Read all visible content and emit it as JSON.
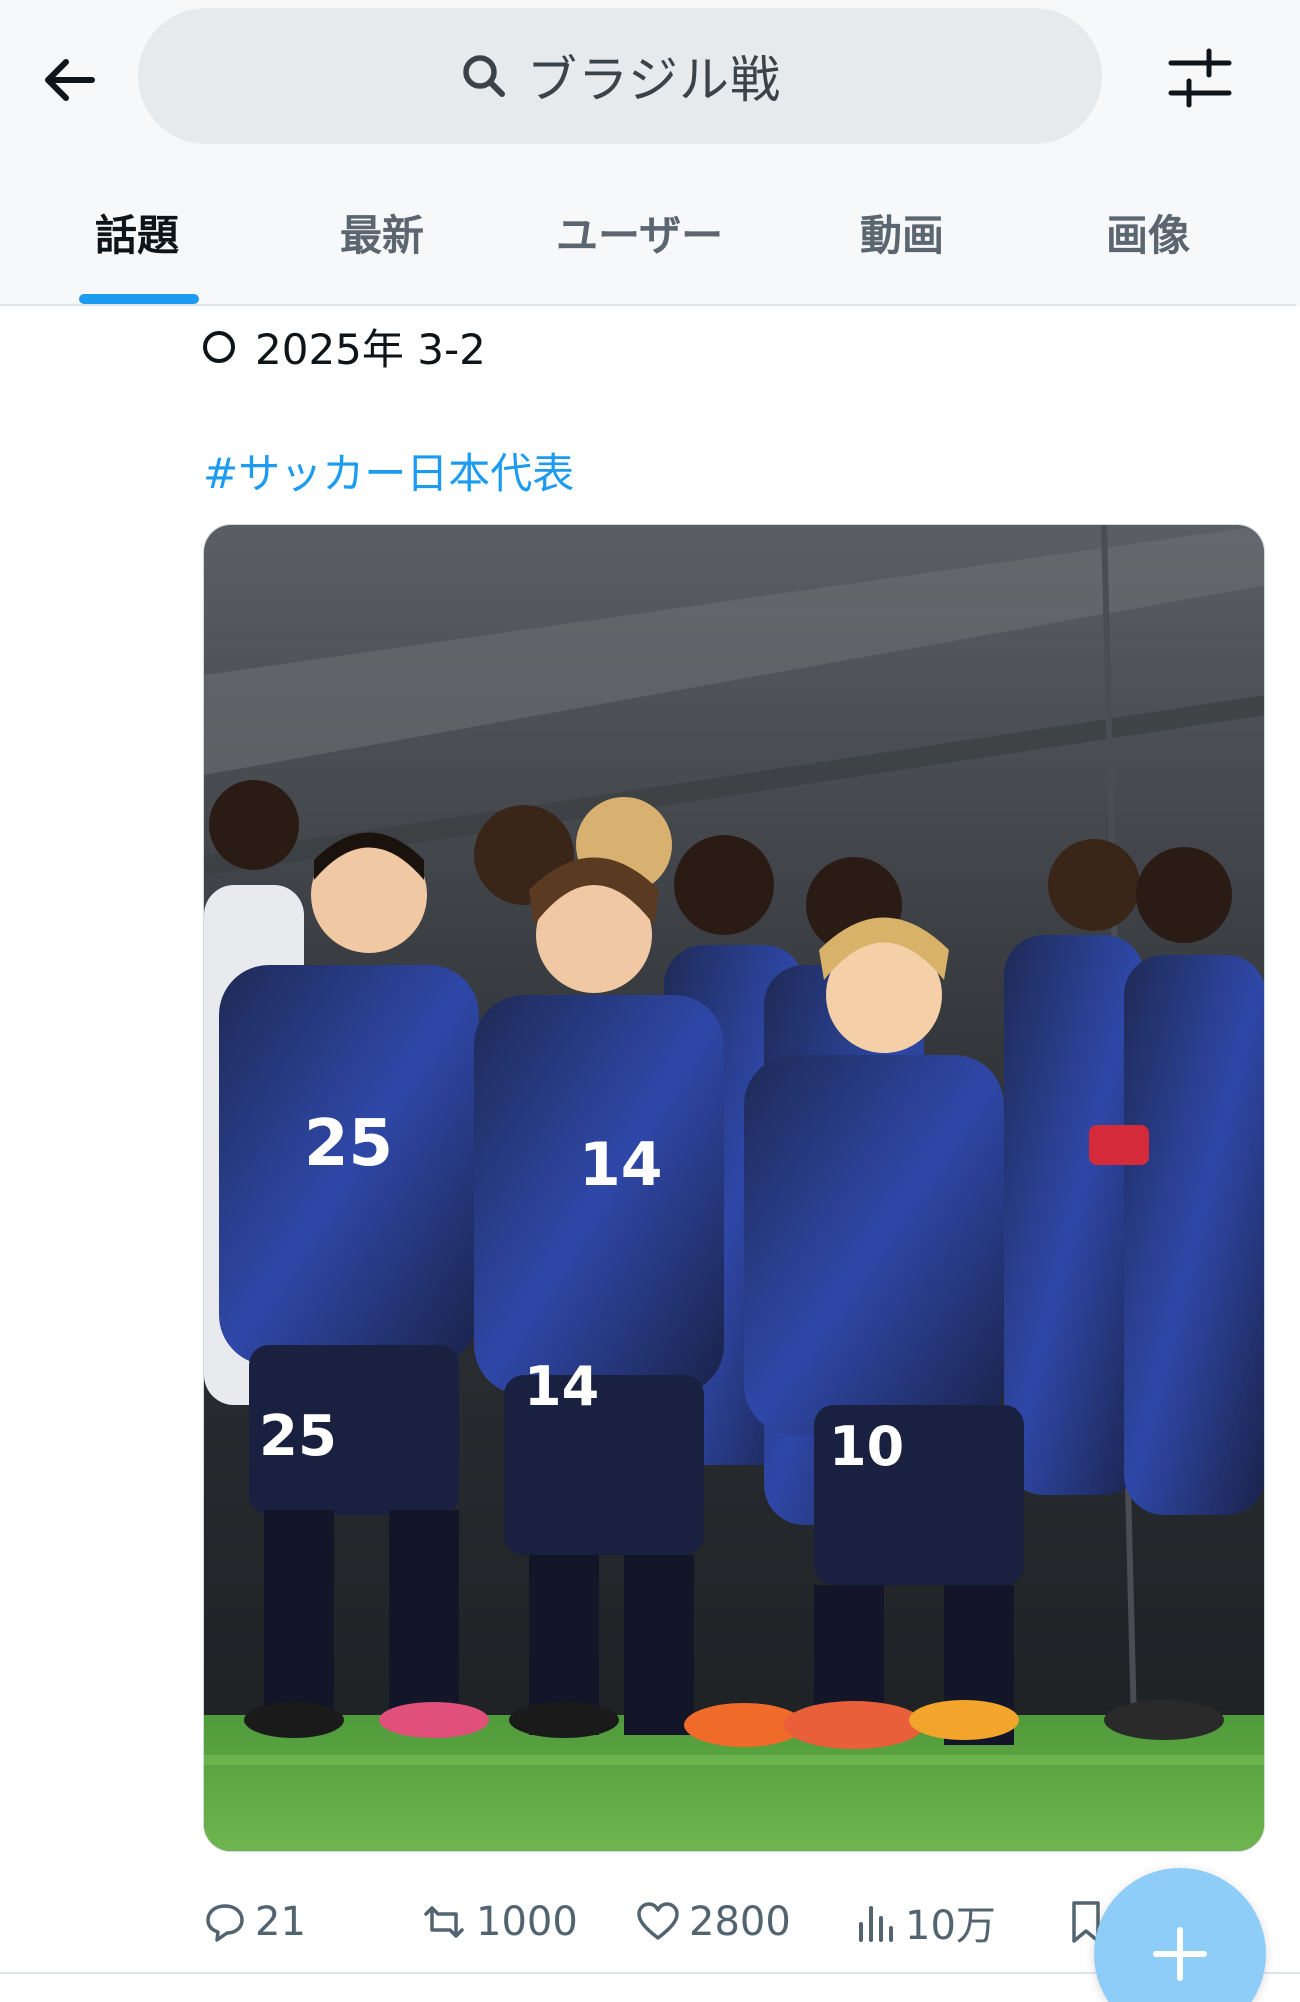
{
  "search": {
    "query": "ブラジル戦"
  },
  "tabs": [
    {
      "label": "話題",
      "active": true
    },
    {
      "label": "最新",
      "active": false
    },
    {
      "label": "ユーザー",
      "active": false
    },
    {
      "label": "動画",
      "active": false
    },
    {
      "label": "画像",
      "active": false
    }
  ],
  "tweet": {
    "result_text": "2025年 3-2",
    "hashtag": "#サッカー日本代表",
    "stats": {
      "replies": "21",
      "retweets": "1000",
      "likes": "2800",
      "views": "10万"
    }
  },
  "colors": {
    "accent": "#1d9bf0",
    "fab": "#8ecdf8",
    "jersey": "#1e2a55",
    "pitch": "#4f9a3a"
  },
  "icons": [
    "back-arrow-icon",
    "search-icon",
    "filter-icon",
    "reply-icon",
    "retweet-icon",
    "like-icon",
    "views-icon",
    "bookmark-icon",
    "share-icon",
    "compose-plus-icon"
  ]
}
